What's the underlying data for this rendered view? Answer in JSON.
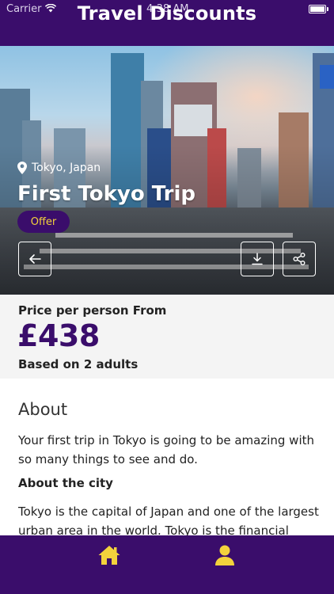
{
  "status_bar": {
    "carrier": "Carrier",
    "time": "4:38 AM"
  },
  "header": {
    "title": "Travel Discounts"
  },
  "hero": {
    "location": "Tokyo, Japan",
    "title": "First Tokyo Trip",
    "badge": "Offer",
    "buttons": {
      "back": "arrow-left-icon",
      "download": "download-icon",
      "share": "share-icon"
    }
  },
  "price": {
    "label": "Price per person From",
    "value": "£438",
    "basis": "Based on 2 adults"
  },
  "about": {
    "heading": "About",
    "text": "Your first trip in Tokyo is going to be amazing with so many things to see and do.",
    "city_heading": "About the city",
    "city_text": "Tokyo is the capital of Japan and one of the largest urban area in the world. Tokyo is the financial center of"
  },
  "bottom_nav": {
    "items": [
      {
        "icon": "home-icon"
      },
      {
        "icon": "user-icon"
      }
    ]
  },
  "colors": {
    "brand": "#3a0d6b",
    "accent": "#f3d23c",
    "price": "#3a0d6b"
  }
}
